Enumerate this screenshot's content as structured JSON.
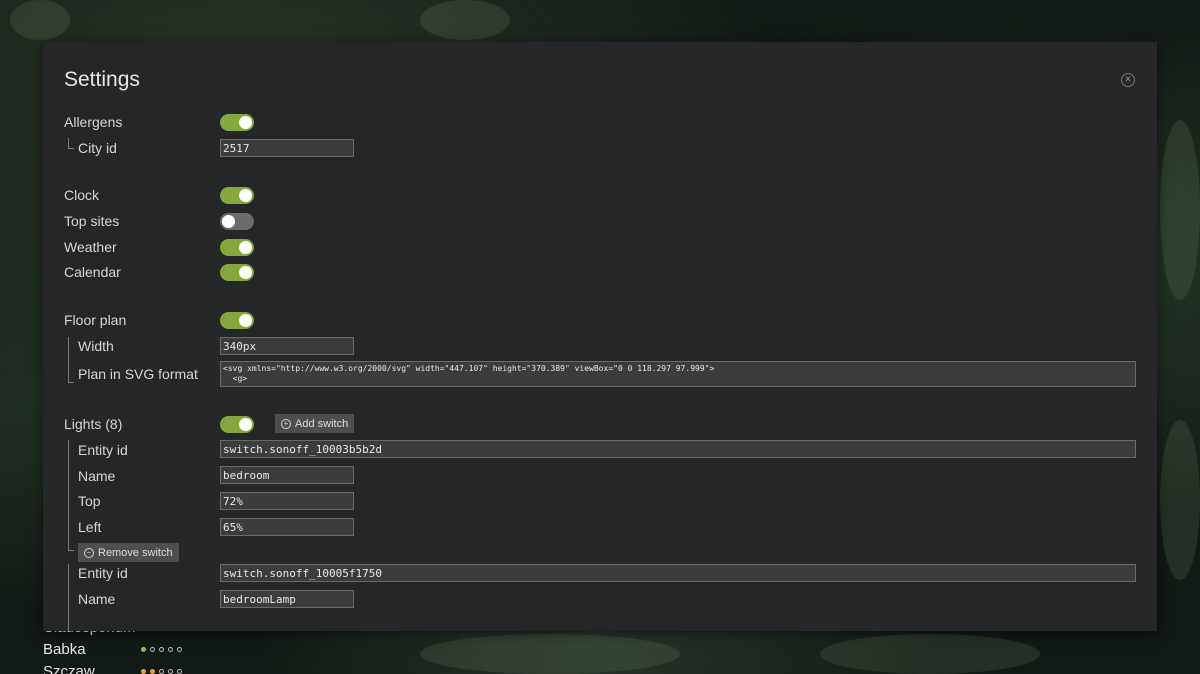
{
  "settings": {
    "title": "Settings",
    "allergens": {
      "label": "Allergens",
      "enabled": true,
      "city_label": "City id",
      "city_value": "2517"
    },
    "clock": {
      "label": "Clock",
      "enabled": true
    },
    "top_sites": {
      "label": "Top sites",
      "enabled": false
    },
    "weather": {
      "label": "Weather",
      "enabled": true
    },
    "calendar": {
      "label": "Calendar",
      "enabled": true
    },
    "floor_plan": {
      "label": "Floor plan",
      "enabled": true,
      "width_label": "Width",
      "width_value": "340px",
      "svg_label": "Plan in SVG format",
      "svg_value": "<svg xmlns=\"http://www.w3.org/2000/svg\" width=\"447.107\" height=\"370.389\" viewBox=\"0 0 118.297 97.999\">\n  <g>"
    },
    "lights": {
      "label": "Lights (8)",
      "enabled": true,
      "add_label": "Add switch",
      "remove_label": "Remove switch",
      "switches": [
        {
          "entity_label": "Entity id",
          "entity_value": "switch.sonoff_10003b5b2d",
          "name_label": "Name",
          "name_value": "bedroom",
          "top_label": "Top",
          "top_value": "72%",
          "left_label": "Left",
          "left_value": "65%"
        },
        {
          "entity_label": "Entity id",
          "entity_value": "switch.sonoff_10005f1750",
          "name_label": "Name",
          "name_value": "bedroomLamp"
        }
      ]
    }
  },
  "background_list": {
    "items": [
      {
        "name": "Cladosporium",
        "level": 0,
        "color": "#8bc34a"
      },
      {
        "name": "Babka",
        "level": 1,
        "color": "#8bc34a"
      },
      {
        "name": "Szczaw",
        "level": 2,
        "color": "#f0a030"
      }
    ]
  },
  "icons": {
    "close": "close-circle-icon",
    "add": "plus-circle-icon",
    "remove": "minus-circle-icon"
  }
}
